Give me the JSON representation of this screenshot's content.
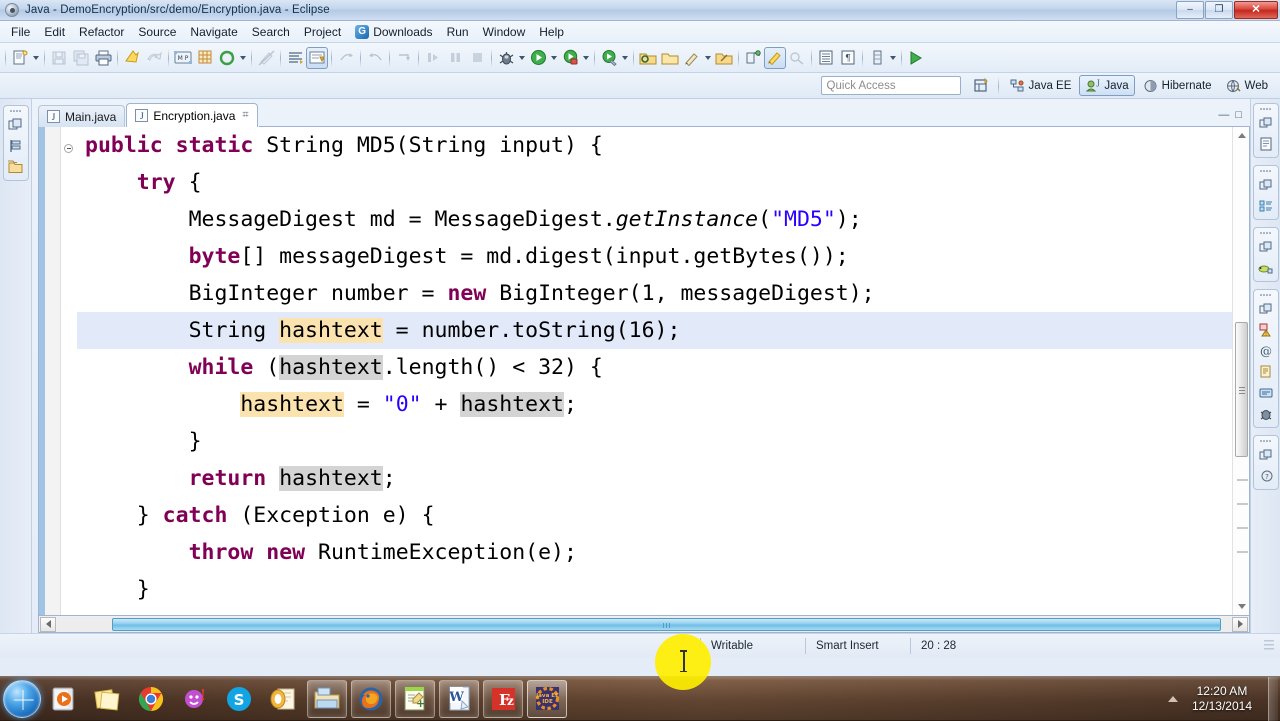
{
  "window": {
    "title": "Java - DemoEncryption/src/demo/Encryption.java - Eclipse",
    "app_icon": "eclipse-icon",
    "buttons": {
      "minimize": "–",
      "restore": "❐",
      "close": "✕"
    }
  },
  "menubar": {
    "items": [
      {
        "label": "File"
      },
      {
        "label": "Edit"
      },
      {
        "label": "Refactor"
      },
      {
        "label": "Source"
      },
      {
        "label": "Navigate"
      },
      {
        "label": "Search"
      },
      {
        "label": "Project"
      },
      {
        "label": "Downloads",
        "icon": "downloads-icon"
      },
      {
        "label": "Run"
      },
      {
        "label": "Window"
      },
      {
        "label": "Help"
      }
    ]
  },
  "toolbar": {
    "groups": [
      [
        "new-wizard",
        "new-dropdown",
        "save",
        "save-all",
        "print"
      ],
      [
        "quick-fix",
        "undo-arrow"
      ],
      [
        "maven-build",
        "new-package",
        "refresh-generate",
        "refresh-dropdown"
      ],
      [
        "link-editor"
      ],
      [
        "next-annotation",
        "toggle-mark-occurrences"
      ],
      [
        "forward-nav",
        "back-nav",
        "step-nav"
      ],
      [
        "debug-step",
        "pause",
        "terminate"
      ],
      [
        "debug-run",
        "debug-dropdown",
        "run",
        "run-dropdown",
        "run-coverage",
        "coverage-dropdown"
      ],
      [
        "external-tools",
        "external-dropdown"
      ],
      [
        "open-type",
        "open-resource",
        "search-reference",
        "search-dropdown",
        "search-declaration"
      ],
      [
        "new-java-project",
        "new-java-class",
        "new-annotation"
      ],
      [
        "open-perspective-list",
        "list-dropdown"
      ],
      [
        "restore-view",
        "restore-dropdown"
      ],
      [
        "forward-play"
      ]
    ]
  },
  "perspective_bar": {
    "quick_access_placeholder": "Quick Access",
    "open_perspective_icon": "open-perspective-icon",
    "perspectives": [
      {
        "label": "Java EE",
        "icon": "java-ee-perspective-icon",
        "active": false
      },
      {
        "label": "Java",
        "icon": "java-perspective-icon",
        "active": true
      },
      {
        "label": "Hibernate",
        "icon": "hibernate-perspective-icon",
        "active": false
      },
      {
        "label": "Web",
        "icon": "web-perspective-icon",
        "active": false
      }
    ]
  },
  "left_fast_view": {
    "groups": [
      {
        "icons": [
          "restore-icon",
          "outline-view-icon",
          "package-explorer-icon"
        ]
      }
    ]
  },
  "right_fast_view": {
    "groups": [
      {
        "icons": [
          "restore-icon",
          "document-view-icon"
        ]
      },
      {
        "icons": [
          "restore-icon",
          "outline-tree-icon"
        ]
      },
      {
        "icons": [
          "restore-icon",
          "hibernate-view-icon"
        ]
      },
      {
        "icons": [
          "restore-icon",
          "problems-view-icon",
          "javadoc-view-icon",
          "declaration-view-icon",
          "console-view-icon",
          "servers-view-icon"
        ]
      },
      {
        "icons": [
          "restore-icon",
          "help-view-icon"
        ]
      }
    ]
  },
  "editor": {
    "tabs": [
      {
        "label": "Main.java",
        "icon": "java-file-icon",
        "active": false,
        "closable": false
      },
      {
        "label": "Encryption.java",
        "icon": "java-file-icon",
        "active": true,
        "closable": true,
        "close_glyph": "⌗"
      }
    ],
    "minimize_glyph": "—",
    "maximize_glyph": "□",
    "current_line_index": 4,
    "code_lines": [
      {
        "indent": 0,
        "fold": true,
        "tokens": [
          {
            "t": "public",
            "c": "kw"
          },
          {
            "t": " ",
            "c": "plain"
          },
          {
            "t": "static",
            "c": "kw"
          },
          {
            "t": " String MD5(String input) {",
            "c": "plain"
          }
        ]
      },
      {
        "indent": 1,
        "fold": false,
        "tokens": [
          {
            "t": "try",
            "c": "kw"
          },
          {
            "t": " {",
            "c": "plain"
          }
        ]
      },
      {
        "indent": 2,
        "fold": false,
        "tokens": [
          {
            "t": "MessageDigest md = MessageDigest.",
            "c": "plain"
          },
          {
            "t": "getInstance",
            "c": "ital"
          },
          {
            "t": "(",
            "c": "plain"
          },
          {
            "t": "\"MD5\"",
            "c": "str"
          },
          {
            "t": ");",
            "c": "plain"
          }
        ]
      },
      {
        "indent": 2,
        "fold": false,
        "tokens": [
          {
            "t": "byte",
            "c": "kw"
          },
          {
            "t": "[] messageDigest = md.digest(input.getBytes());",
            "c": "plain"
          }
        ]
      },
      {
        "indent": 2,
        "fold": false,
        "tokens": [
          {
            "t": "BigInteger number = ",
            "c": "plain"
          },
          {
            "t": "new",
            "c": "kw"
          },
          {
            "t": " BigInteger(1, messageDigest);",
            "c": "plain"
          }
        ]
      },
      {
        "indent": 2,
        "fold": false,
        "current": true,
        "tokens": [
          {
            "t": "String ",
            "c": "plain"
          },
          {
            "t": "hashtext",
            "c": "occ-w"
          },
          {
            "t": " = number.toString(16);",
            "c": "plain"
          }
        ]
      },
      {
        "indent": 2,
        "fold": false,
        "tokens": [
          {
            "t": "while",
            "c": "kw"
          },
          {
            "t": " (",
            "c": "plain"
          },
          {
            "t": "hashtext",
            "c": "occ-r"
          },
          {
            "t": ".length() < 32) {",
            "c": "plain"
          }
        ]
      },
      {
        "indent": 3,
        "fold": false,
        "tokens": [
          {
            "t": "hashtext",
            "c": "occ-w"
          },
          {
            "t": " = ",
            "c": "plain"
          },
          {
            "t": "\"0\"",
            "c": "str"
          },
          {
            "t": " + ",
            "c": "plain"
          },
          {
            "t": "hashtext",
            "c": "occ-r"
          },
          {
            "t": ";",
            "c": "plain"
          }
        ]
      },
      {
        "indent": 2,
        "fold": false,
        "tokens": [
          {
            "t": "}",
            "c": "plain"
          }
        ]
      },
      {
        "indent": 2,
        "fold": false,
        "tokens": [
          {
            "t": "return",
            "c": "kw"
          },
          {
            "t": " ",
            "c": "plain"
          },
          {
            "t": "hashtext",
            "c": "occ-r"
          },
          {
            "t": ";",
            "c": "plain"
          }
        ]
      },
      {
        "indent": 1,
        "fold": false,
        "tokens": [
          {
            "t": "} ",
            "c": "plain"
          },
          {
            "t": "catch",
            "c": "kw"
          },
          {
            "t": " (Exception e) {",
            "c": "plain"
          }
        ]
      },
      {
        "indent": 2,
        "fold": false,
        "tokens": [
          {
            "t": "throw",
            "c": "kw"
          },
          {
            "t": " ",
            "c": "plain"
          },
          {
            "t": "new",
            "c": "kw"
          },
          {
            "t": " RuntimeException(e);",
            "c": "plain"
          }
        ]
      },
      {
        "indent": 1,
        "fold": false,
        "tokens": [
          {
            "t": "}",
            "c": "plain"
          }
        ]
      }
    ]
  },
  "statusbar": {
    "writable": "Writable",
    "insert_mode": "Smart Insert",
    "cursor_position": "20 : 28"
  },
  "taskbar": {
    "start_button": "start-orb",
    "items": [
      {
        "name": "windows-media-player-icon",
        "state": "pinned"
      },
      {
        "name": "sticky-notes-icon",
        "state": "pinned"
      },
      {
        "name": "google-chrome-icon",
        "state": "pinned"
      },
      {
        "name": "yahoo-messenger-icon",
        "state": "pinned"
      },
      {
        "name": "skype-icon",
        "state": "pinned"
      },
      {
        "name": "microsoft-outlook-icon",
        "state": "pinned"
      },
      {
        "name": "windows-explorer-icon",
        "state": "running"
      },
      {
        "name": "mozilla-firefox-icon",
        "state": "running"
      },
      {
        "name": "notepad-plus-plus-icon",
        "state": "running"
      },
      {
        "name": "microsoft-word-icon",
        "state": "running"
      },
      {
        "name": "filezilla-icon",
        "state": "running"
      },
      {
        "name": "eclipse-java-ee-ide-icon",
        "state": "active",
        "label": "Java EE IDE"
      }
    ],
    "tray": {
      "show_hidden_icons": "tray-arrow-icon"
    },
    "clock": {
      "time": "12:20 AM",
      "date": "12/13/2014"
    }
  },
  "colors": {
    "keyword": "#7f0055",
    "string": "#2a00ff",
    "write_occurrence": "#fbe3b0",
    "read_occurrence": "#d4d4d4",
    "current_line": "#e2eafa",
    "accent": "#1b6fbf"
  }
}
